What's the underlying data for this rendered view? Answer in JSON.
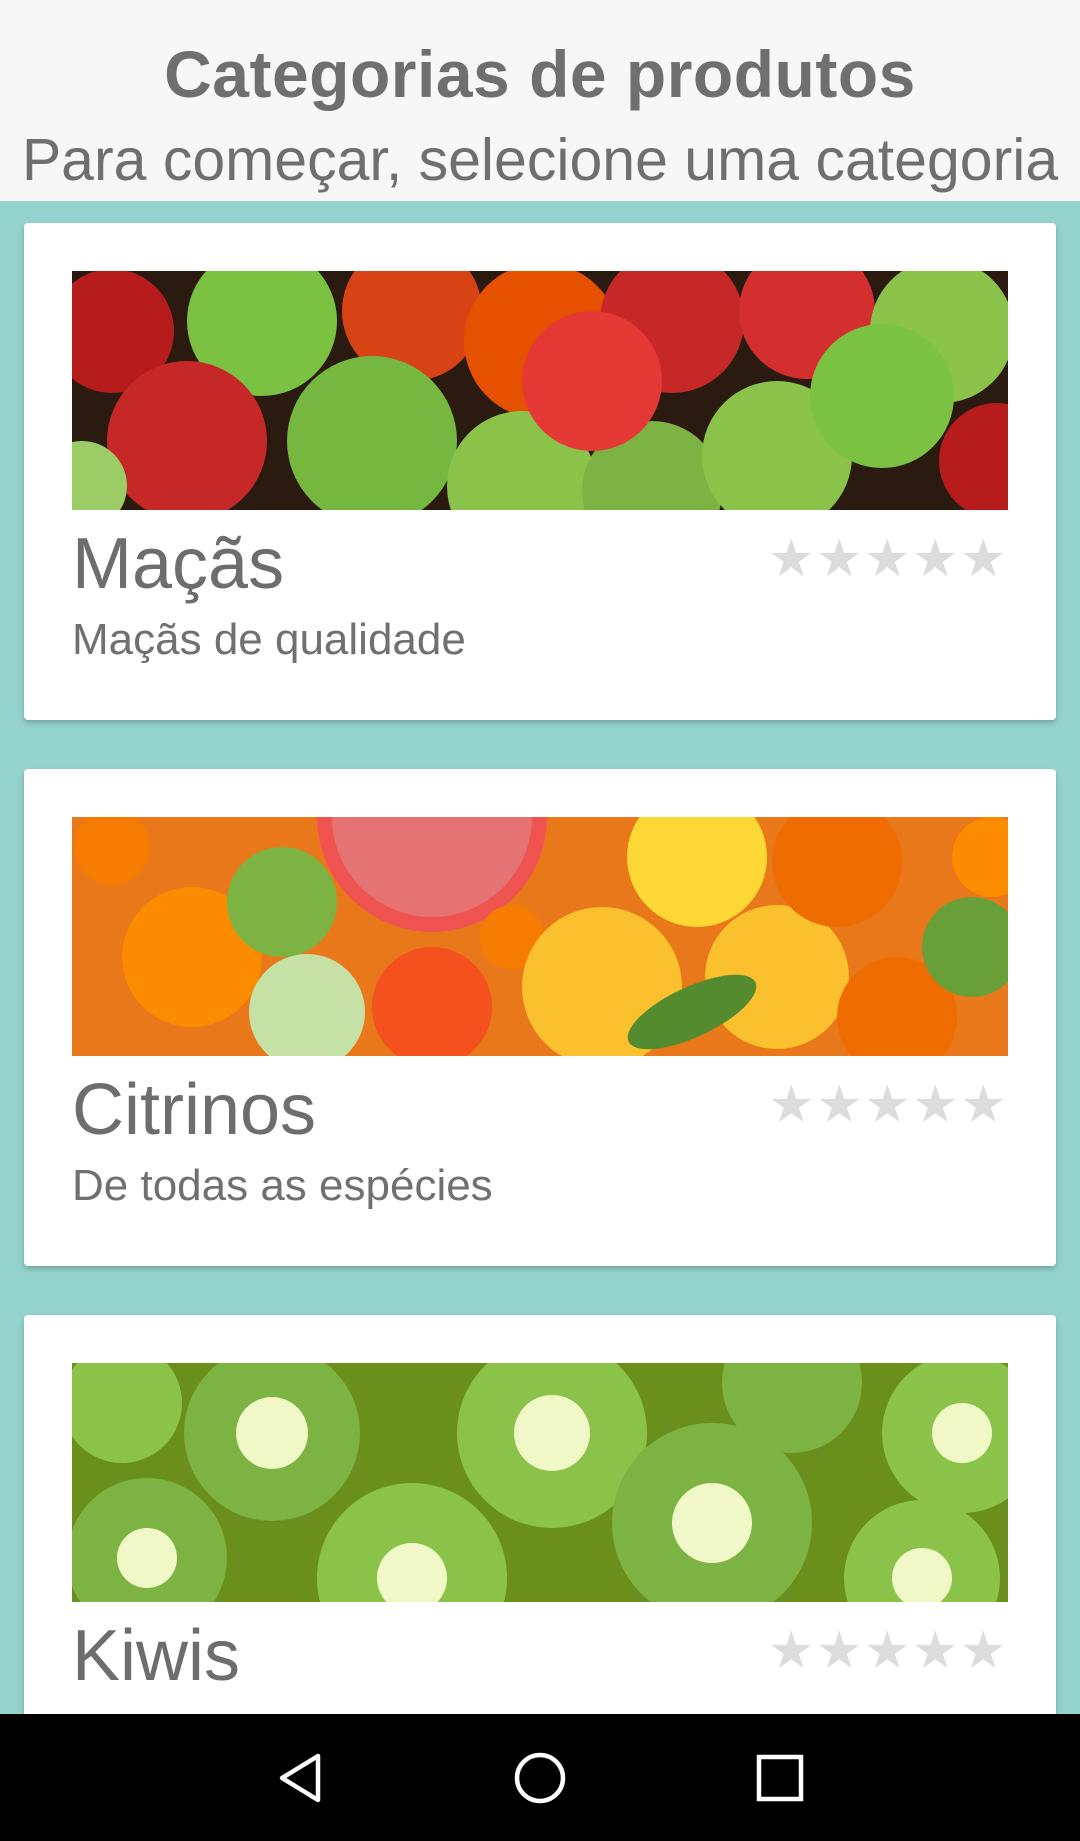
{
  "header": {
    "title": "Categorias de produtos",
    "subtitle": "Para começar, selecione uma categoria"
  },
  "categories": [
    {
      "name": "Maçãs",
      "description": "Maçãs de qualidade",
      "rating": 0,
      "max_rating": 5,
      "image": "apples-photo"
    },
    {
      "name": "Citrinos",
      "description": "De todas as espécies",
      "rating": 0,
      "max_rating": 5,
      "image": "citrus-photo"
    },
    {
      "name": "Kiwis",
      "description": "",
      "rating": 0,
      "max_rating": 5,
      "image": "kiwis-photo"
    }
  ],
  "rating_star": "★",
  "colors": {
    "list_background": "#94d3cd",
    "card_background": "#ffffff",
    "text_gray": "#6f6f6f",
    "star_empty": "#dcdcdc",
    "navbar": "#000000"
  },
  "navbar": {
    "buttons": [
      "back-icon",
      "home-icon",
      "recents-icon"
    ]
  }
}
